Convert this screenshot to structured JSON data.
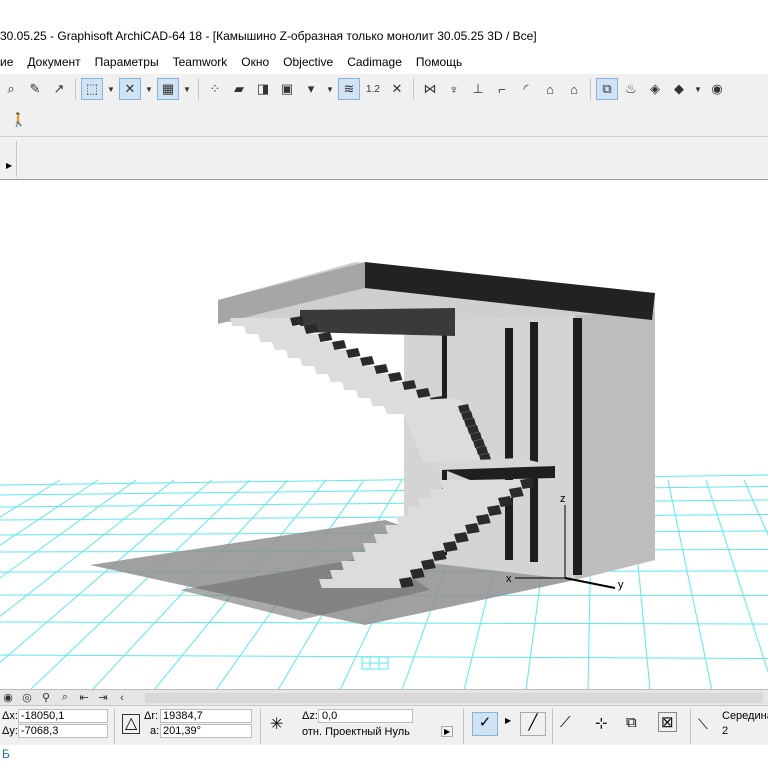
{
  "window": {
    "title": "30.05.25 - Graphisoft ArchiCAD-64 18 - [Камышино Z-образная только монолит 30.05.25 3D / Все]"
  },
  "menu": {
    "items": [
      "ие",
      "Документ",
      "Параметры",
      "Teamwork",
      "Окно",
      "Objective",
      "Cadimage",
      "Помощь"
    ]
  },
  "toolbar": {
    "icons": [
      "magnify-icon",
      "eyedropper-icon",
      "arrow-select-icon",
      "marquee-icon",
      "layers-icon",
      "grid-snap-icon",
      "slab-icon",
      "wall-icon",
      "object-icon",
      "figure-icon",
      "zone-icon",
      "dimension-icon",
      "close-icon",
      "beam-icon",
      "column-icon",
      "stair-icon",
      "roof-icon",
      "shell-icon",
      "mesh-icon",
      "house-icon",
      "select-3d-icon",
      "render-icon",
      "view-icon",
      "material-icon",
      "globe-icon"
    ],
    "dimension_label": "1.2",
    "walk_icon": "walk-icon"
  },
  "axes": {
    "x": "x",
    "y": "y",
    "z": "z"
  },
  "infobox": {
    "dx_label": "Δx:",
    "dx_value": "-18050,1",
    "dy_label": "Δy:",
    "dy_value": "-7068,3",
    "dr_label": "Δr:",
    "dr_value": "19384,7",
    "a_label": "a:",
    "a_value": "201,39°",
    "dz_label": "Δz:",
    "dz_value": "0,0",
    "ref_label": "отн. Проектный Нуль",
    "snap_label": "Середина",
    "snap_value": "2"
  },
  "status": {
    "text": "Б"
  },
  "colors": {
    "grid": "#5ee8ee",
    "floor": "#8c8c8c",
    "tread": "#dcdcdc",
    "riser": "#2a2a2a",
    "wall": "#cfcfcf",
    "accent": "#cfe3f5"
  }
}
